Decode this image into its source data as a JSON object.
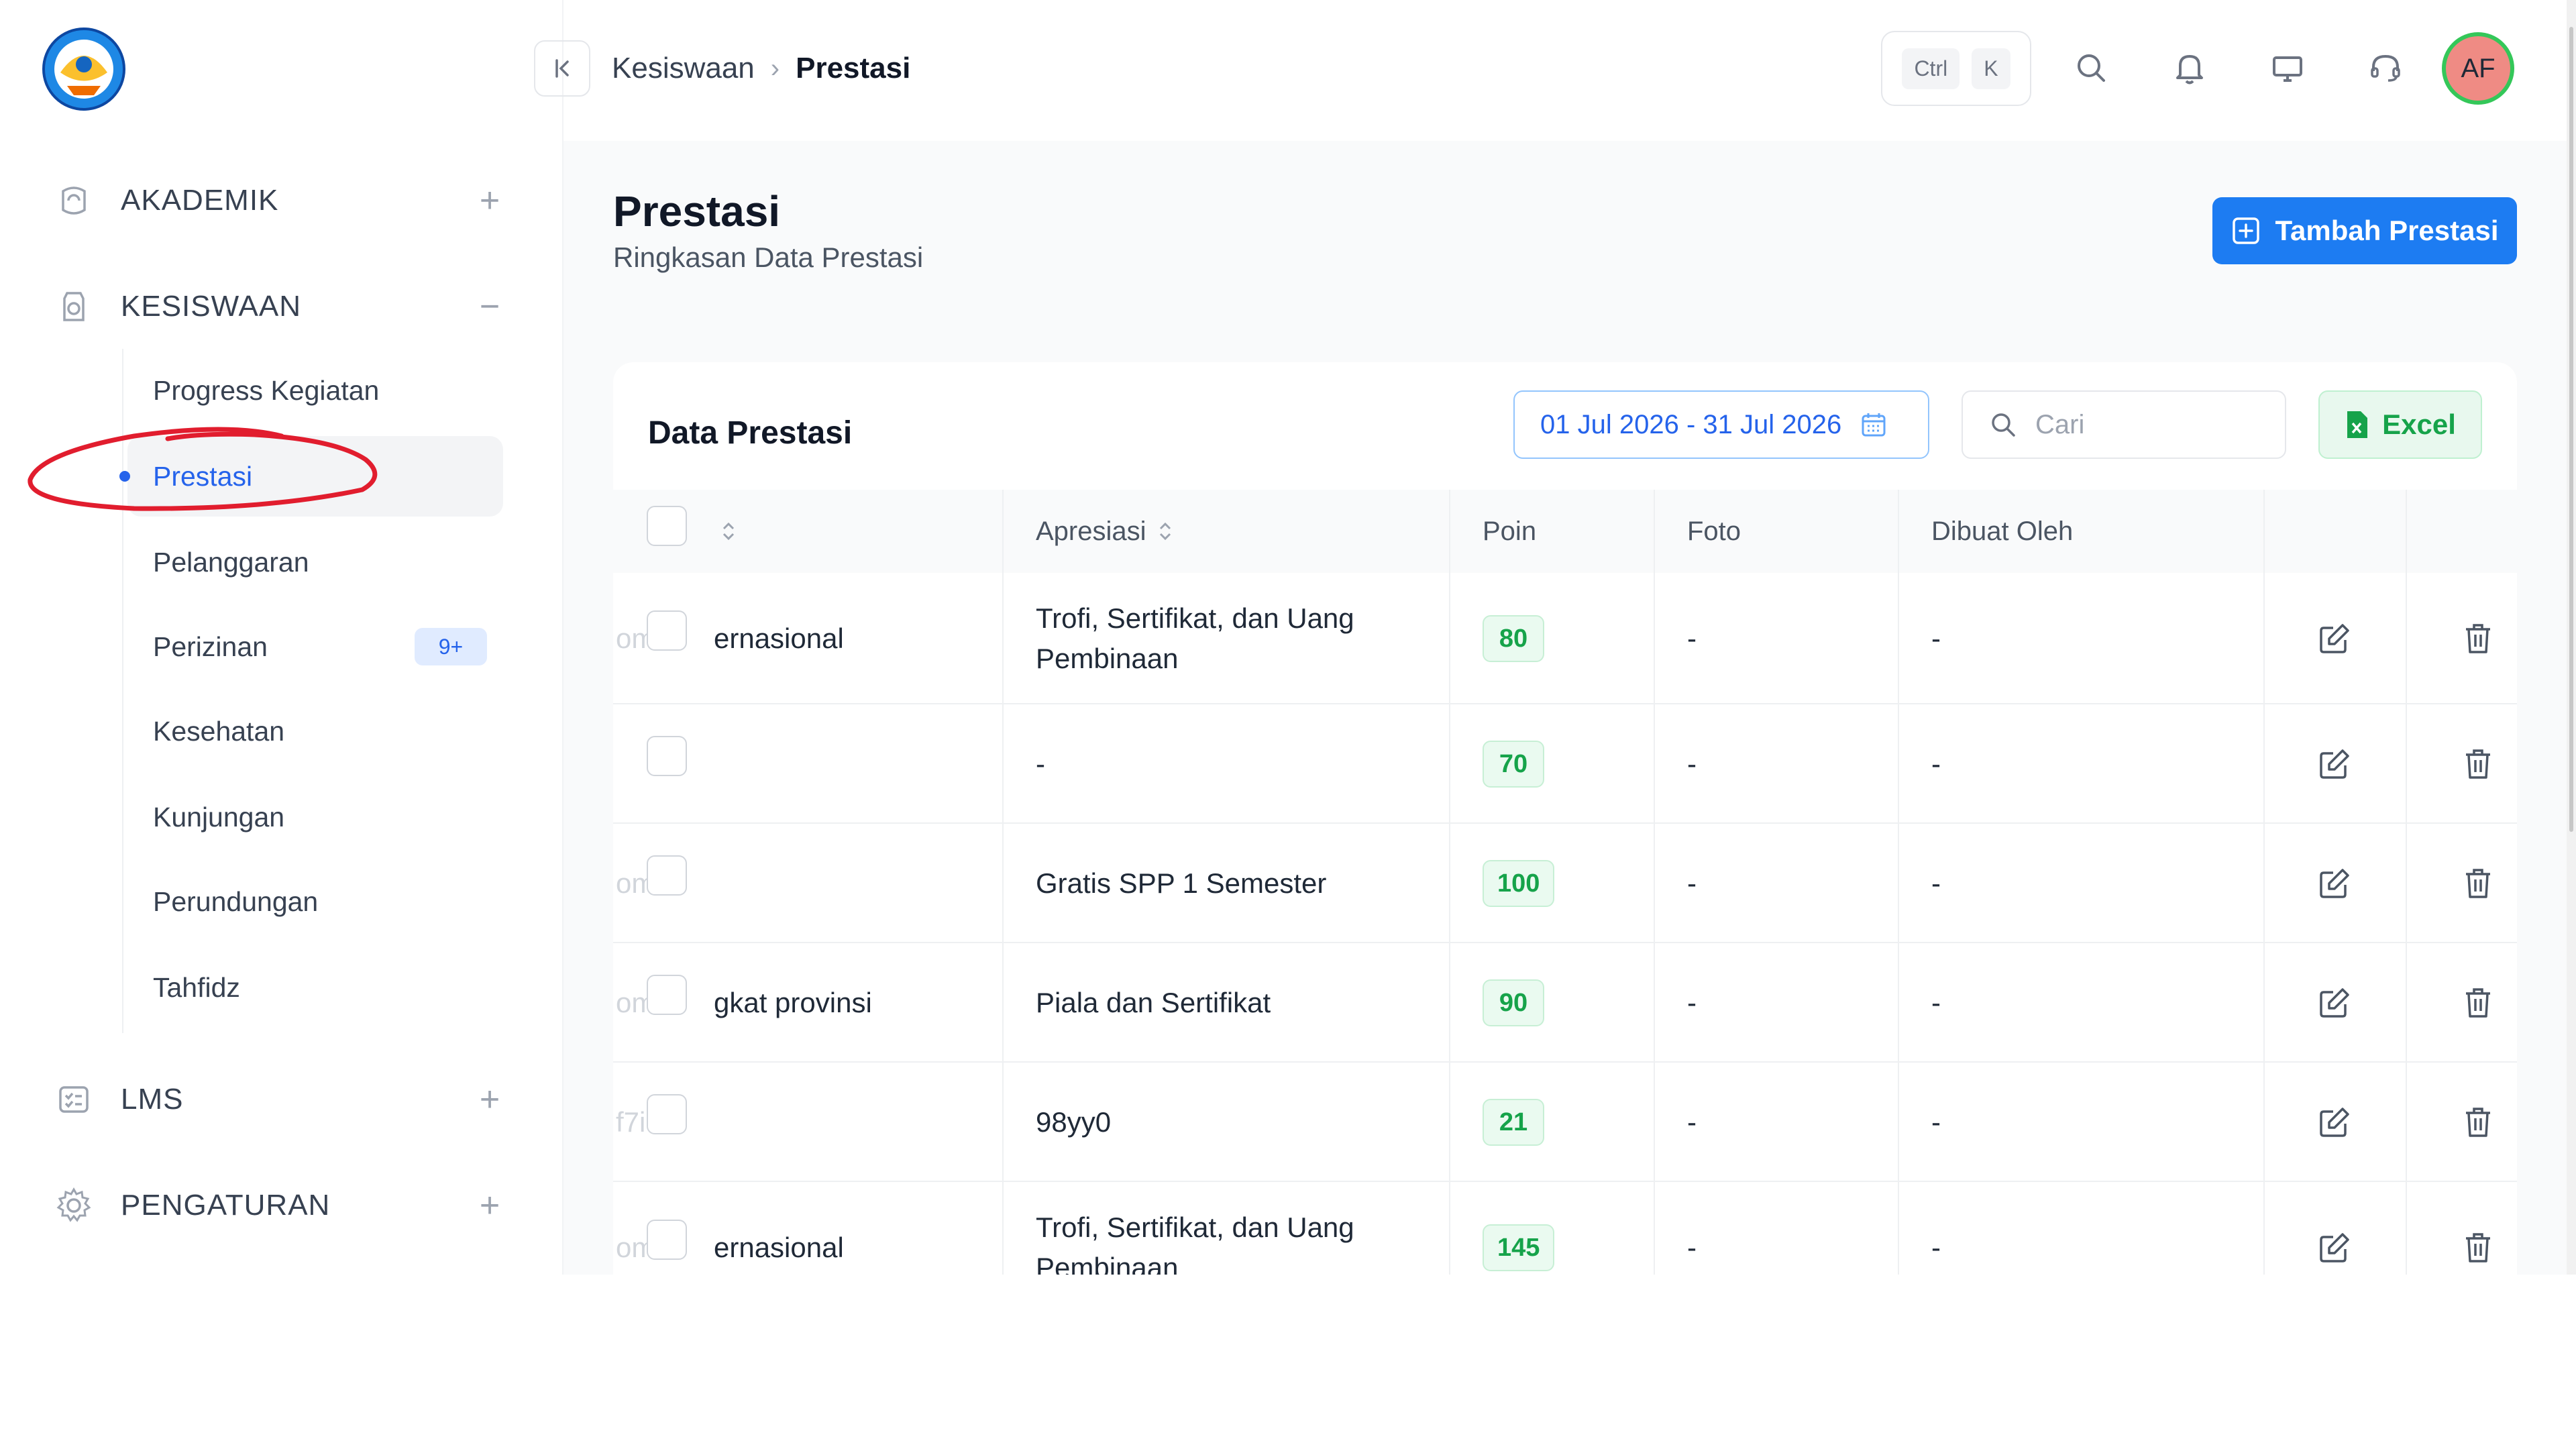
{
  "sidebar": {
    "groups": [
      {
        "label": "AKADEMIK",
        "toggle": "+",
        "icon": "academic-icon"
      },
      {
        "label": "KESISWAAN",
        "toggle": "−",
        "icon": "student-affairs-icon"
      },
      {
        "label": "LMS",
        "toggle": "+",
        "icon": "lms-icon"
      },
      {
        "label": "PENGATURAN",
        "toggle": "+",
        "icon": "gear-icon"
      }
    ],
    "sub_items": [
      {
        "label": "Progress Kegiatan"
      },
      {
        "label": "Prestasi",
        "active": true
      },
      {
        "label": "Pelanggaran"
      },
      {
        "label": "Perizinan",
        "badge": "9+"
      },
      {
        "label": "Kesehatan"
      },
      {
        "label": "Kunjungan"
      },
      {
        "label": "Perundungan"
      },
      {
        "label": "Tahfidz"
      }
    ]
  },
  "header": {
    "breadcrumb": [
      "Kesiswaan",
      "Prestasi"
    ],
    "shortcut": [
      "Ctrl",
      "K"
    ],
    "icons": [
      "search-icon",
      "bell-icon",
      "monitor-icon",
      "headset-icon"
    ],
    "avatar_initials": "AF"
  },
  "page": {
    "title": "Prestasi",
    "subtitle": "Ringkasan Data Prestasi",
    "add_button": "Tambah Prestasi"
  },
  "card": {
    "title": "Data Prestasi",
    "date_range": "01 Jul 2026 - 31 Jul 2026",
    "search_placeholder": "Cari",
    "excel_label": "Excel"
  },
  "table": {
    "headers": [
      "Apresiasi",
      "Poin",
      "Foto",
      "Dibuat Oleh"
    ],
    "rows": [
      {
        "lead": "ernasional",
        "ghost": "om  ln",
        "apresiasi": "Trofi, Sertifikat, dan Uang Pembinaan",
        "poin": "80",
        "foto": "-",
        "dibuat_oleh": "-"
      },
      {
        "lead": "",
        "ghost": "",
        "apresiasi": "-",
        "poin": "70",
        "foto": "-",
        "dibuat_oleh": "-"
      },
      {
        "lead": "",
        "ghost": "om",
        "apresiasi": "Gratis SPP 1 Semester",
        "poin": "100",
        "foto": "-",
        "dibuat_oleh": "-"
      },
      {
        "lead": "gkat provinsi",
        "ghost": "om  ti",
        "apresiasi": "Piala dan Sertifikat",
        "poin": "90",
        "foto": "-",
        "dibuat_oleh": "-"
      },
      {
        "lead": "",
        "ghost": "f7i",
        "apresiasi": "98yy0",
        "poin": "21",
        "foto": "-",
        "dibuat_oleh": "-"
      },
      {
        "lead": "ernasional",
        "ghost": "om  ln",
        "apresiasi": "Trofi, Sertifikat, dan Uang Pembinaan",
        "poin": "145",
        "foto": "-",
        "dibuat_oleh": "-"
      }
    ]
  },
  "colors": {
    "accent": "#1d7cf2",
    "success": "#16a34a",
    "annotation": "#e11d2e",
    "avatar_bg": "#ef8b84"
  }
}
